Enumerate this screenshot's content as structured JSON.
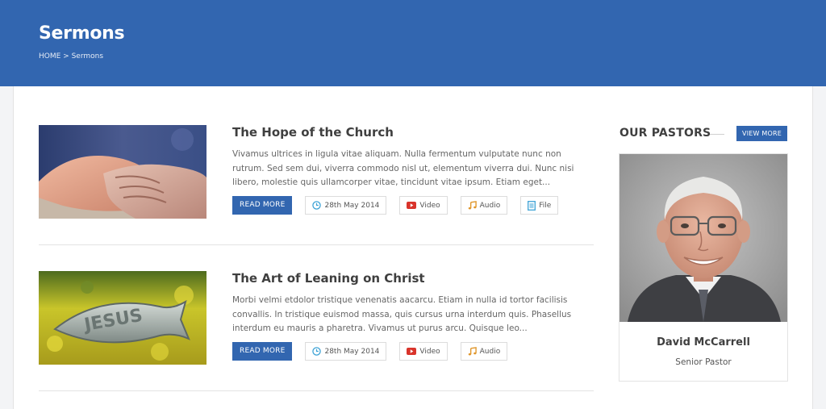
{
  "header": {
    "title": "Sermons",
    "breadcrumb": "HOME > Sermons"
  },
  "sermons": [
    {
      "title": "The Hope of the Church",
      "excerpt": "Vivamus ultrices in ligula vitae aliquam. Nulla fermentum vulputate nunc non rutrum. Sed sem dui, viverra commodo nisl ut, elementum viverra dui. Nunc nisi libero, molestie quis ullamcorper vitae, tincidunt vitae ipsum. Etiam eget...",
      "read_more": "READ MORE",
      "date": "28th May 2014",
      "video": "Video",
      "audio": "Audio",
      "file": "File"
    },
    {
      "title": "The Art of Leaning on Christ",
      "excerpt": "Morbi velmi etdolor tristique venenatis aacarcu. Etiam in nulla id tortor facilisis convallis. In tristique euismod massa, quis cursus urna interdum quis. Phasellus interdum eu mauris a pharetra. Vivamus ut purus arcu. Quisque leo...",
      "read_more": "READ MORE",
      "date": "28th May 2014",
      "video": "Video",
      "audio": "Audio"
    }
  ],
  "pastors": {
    "heading": "OUR PASTORS",
    "view_more": "VIEW MORE",
    "name": "David McCarrell",
    "role": "Senior Pastor"
  },
  "icons": {
    "date": "clock-icon",
    "video": "youtube-play-icon",
    "audio": "music-note-icon",
    "file": "document-icon"
  },
  "colors": {
    "brand": "#3266b0",
    "clock": "#3ea3d6",
    "video": "#d9342b",
    "audio": "#e0962a",
    "file": "#3ea3d6"
  }
}
